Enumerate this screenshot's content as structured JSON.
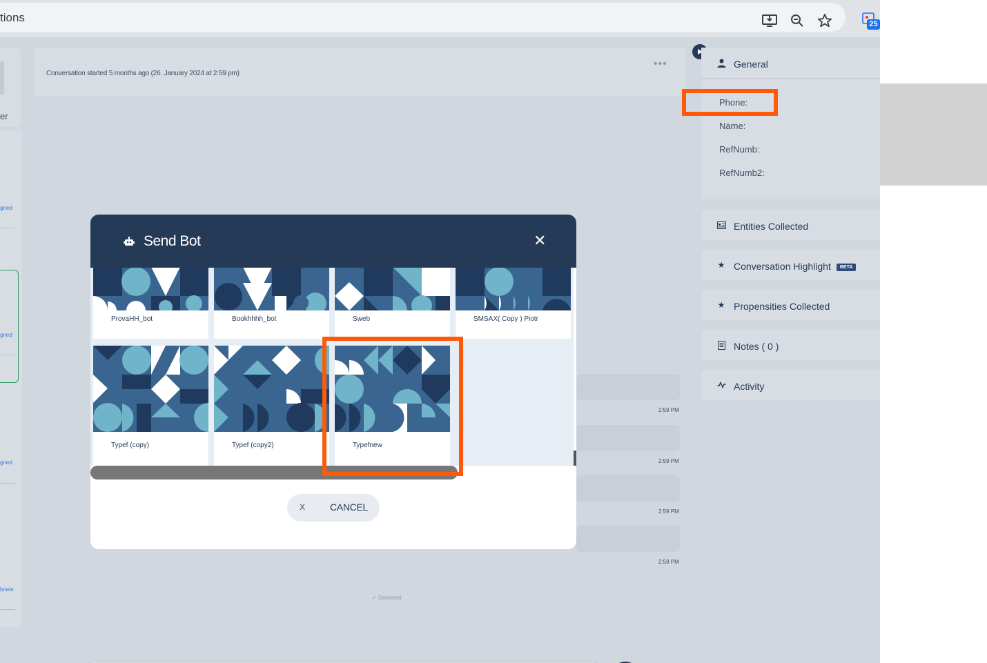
{
  "browser": {
    "url_fragment": "tions",
    "icons": [
      "install-icon",
      "zoom-out-icon",
      "bookmark-star-icon",
      "extension-calendar-icon"
    ],
    "extension_badge": "25"
  },
  "left_panel": {
    "partial_label": "er",
    "items": [
      "gned",
      "gned",
      "gned",
      "briele"
    ]
  },
  "conversation": {
    "started_text": "Conversation started 5 months ago (26. January 2024 at 2:59 pm)",
    "messages": [
      {
        "time": "2:59 PM"
      },
      {
        "time": "2:59 PM"
      },
      {
        "time": "2:59 PM"
      },
      {
        "time": "2:59 PM"
      }
    ],
    "delivered": "Delivered"
  },
  "side_panel": {
    "general": {
      "title": "General",
      "fields": [
        "Phone:",
        "Name:",
        "RefNumb:",
        "RefNumb2:"
      ]
    },
    "sections": [
      {
        "title": "Entities Collected",
        "icon": "id-card-icon"
      },
      {
        "title": "Conversation Highlight",
        "icon": "star-icon",
        "badge": "BETA"
      },
      {
        "title": "Propensities Collected",
        "icon": "star-icon"
      },
      {
        "title": "Notes ( 0 )",
        "icon": "notes-icon"
      },
      {
        "title": "Activity",
        "icon": "activity-icon"
      }
    ]
  },
  "modal": {
    "title": "Send Bot",
    "bots_row1": [
      "ProvaHH_bot",
      "Bookhhhh_bot",
      "Sweb",
      "SMSAX( Copy ) Piotr"
    ],
    "bots_row2": [
      "Typef (copy)",
      "Typef (copy2)",
      "Typefnew"
    ],
    "cancel_x": "X",
    "cancel_label": "CANCEL"
  },
  "colors": {
    "navy": "#253a57",
    "highlight": "#ff5a0a",
    "pattern_dark": "#1f3a5c",
    "pattern_mid": "#3a6591",
    "pattern_light": "#6fb4c8"
  }
}
